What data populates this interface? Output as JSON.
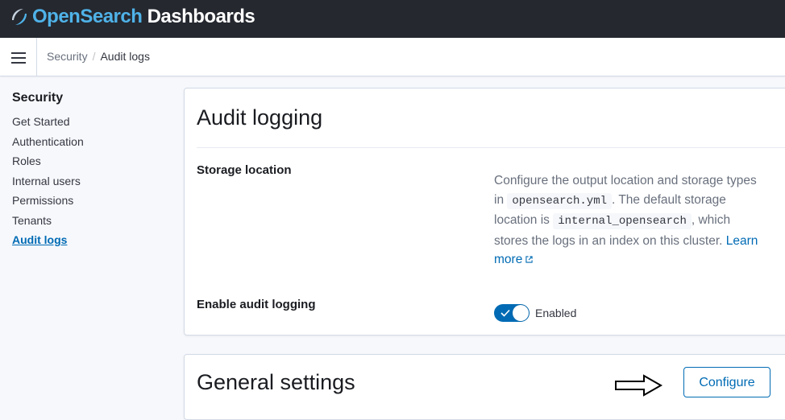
{
  "app": {
    "logo_open": "Open",
    "logo_search": "Search",
    "logo_dashboards": " Dashboards"
  },
  "breadcrumb": {
    "parent": "Security",
    "separator": "/",
    "current": "Audit logs"
  },
  "sidenav": {
    "title": "Security",
    "items": [
      {
        "label": "Get Started"
      },
      {
        "label": "Authentication"
      },
      {
        "label": "Roles"
      },
      {
        "label": "Internal users"
      },
      {
        "label": "Permissions"
      },
      {
        "label": "Tenants"
      },
      {
        "label": "Audit logs"
      }
    ]
  },
  "audit_panel": {
    "title": "Audit logging",
    "storage_label": "Storage location",
    "desc_1": "Configure the output location and storage types in ",
    "desc_code_1": "opensearch.yml",
    "desc_2": ". The default storage location is ",
    "desc_code_2": "internal_opensearch",
    "desc_3": ", which stores the logs in an index on this cluster. ",
    "learn_more": "Learn more",
    "enable_label": "Enable audit logging",
    "toggle_state": "Enabled",
    "toggle_on": true
  },
  "general_panel": {
    "title": "General settings",
    "configure_label": "Configure"
  },
  "colors": {
    "accent": "#006bb4",
    "header_bg": "#25282f",
    "logo_blue": "#4fb2e8"
  },
  "icons": [
    "opensearch-logo-icon",
    "menu-icon",
    "external-link-icon",
    "check-icon",
    "arrow-right-icon"
  ]
}
